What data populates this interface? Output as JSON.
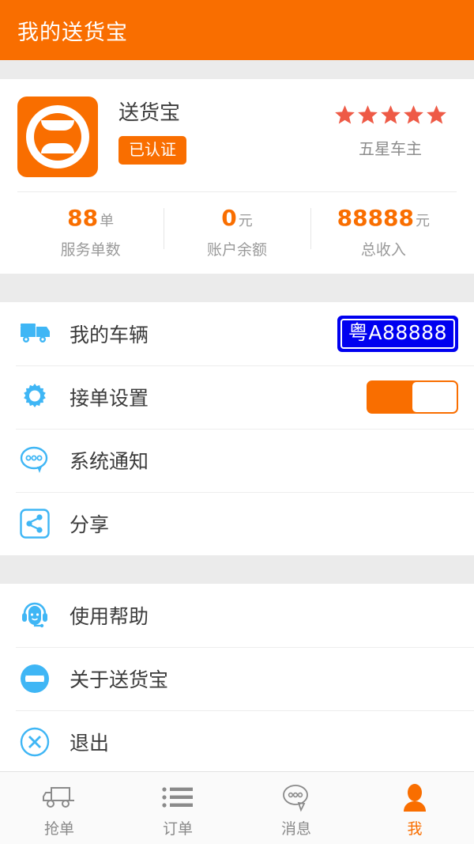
{
  "header": {
    "title": "我的送货宝",
    "background": "#f96e00",
    "text_color": "#ffffff"
  },
  "colors": {
    "accent": "#f96e00",
    "icon_blue": "#3fb6f5",
    "star": "#ee5a46",
    "plate_blue": "#0000f0",
    "page_bg": "#ebebeb"
  },
  "profile": {
    "avatar_logo_text": "送货宝",
    "name": "送货宝",
    "verified_label": "已认证",
    "rating_stars": 5,
    "rating_label": "五星车主",
    "stats": [
      {
        "value": "88",
        "unit": "单",
        "label": "服务单数"
      },
      {
        "value": "0",
        "unit": "元",
        "label": "账户余额"
      },
      {
        "value": "88888",
        "unit": "元",
        "label": "总收入"
      }
    ]
  },
  "menu_group_1": [
    {
      "icon": "truck-icon",
      "label": "我的车辆",
      "value_type": "plate",
      "plate_text": "粤A88888"
    },
    {
      "icon": "gear-icon",
      "label": "接单设置",
      "value_type": "toggle",
      "toggle_on": true
    },
    {
      "icon": "chat-bubble-icon",
      "label": "系统通知",
      "value_type": "none"
    },
    {
      "icon": "share-icon",
      "label": "分享",
      "value_type": "none"
    }
  ],
  "menu_group_2": [
    {
      "icon": "headset-support-icon",
      "label": "使用帮助"
    },
    {
      "icon": "app-logo-icon",
      "label": "关于送货宝"
    },
    {
      "icon": "close-circle-icon",
      "label": "退出"
    }
  ],
  "tabbar": {
    "items": [
      {
        "icon": "truck-outline-icon",
        "label": "抢单",
        "active": false
      },
      {
        "icon": "list-icon",
        "label": "订单",
        "active": false
      },
      {
        "icon": "message-bubble-icon",
        "label": "消息",
        "active": false
      },
      {
        "icon": "person-icon",
        "label": "我",
        "active": true
      }
    ]
  }
}
